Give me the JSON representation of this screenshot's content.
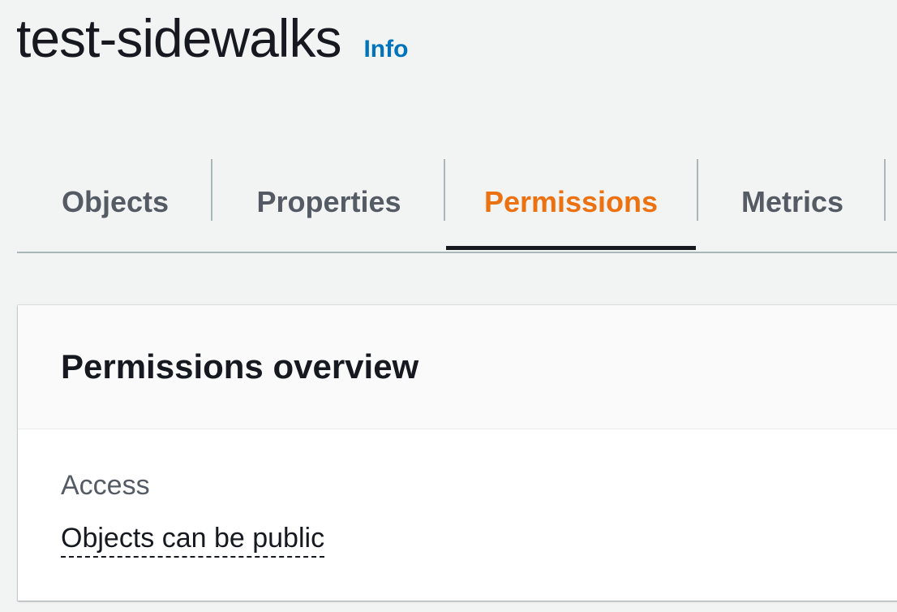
{
  "header": {
    "title": "test-sidewalks",
    "info_link": "Info"
  },
  "tabs": [
    {
      "label": "Objects",
      "active": false
    },
    {
      "label": "Properties",
      "active": false
    },
    {
      "label": "Permissions",
      "active": true
    },
    {
      "label": "Metrics",
      "active": false
    }
  ],
  "permissions_panel": {
    "title": "Permissions overview",
    "access_label": "Access",
    "access_value": "Objects can be public"
  },
  "colors": {
    "active_tab": "#ec7211",
    "link": "#0073bb",
    "text": "#16191f",
    "muted_text": "#545b64",
    "background": "#f2f3f3"
  }
}
